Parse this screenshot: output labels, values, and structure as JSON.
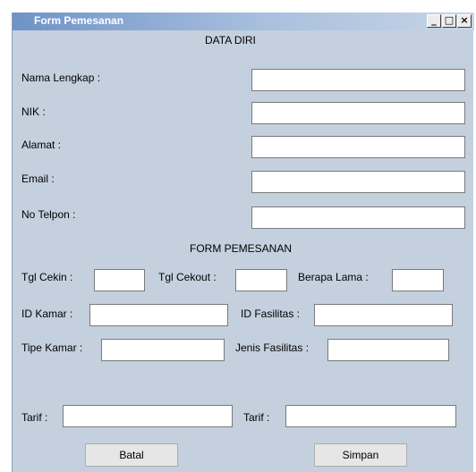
{
  "window": {
    "title": "Form Pemesanan",
    "controls": {
      "minimize": "_",
      "maximize": "□",
      "close": "×"
    }
  },
  "data_diri": {
    "heading": "DATA DIRI",
    "nama_label": "Nama Lengkap :",
    "nama_value": "",
    "nik_label": "NIK :",
    "nik_value": "",
    "alamat_label": "Alamat :",
    "alamat_value": "",
    "email_label": "Email :",
    "email_value": "",
    "telpon_label": "No Telpon :",
    "telpon_value": ""
  },
  "pemesanan": {
    "heading": "FORM PEMESANAN",
    "cekin_label": "Tgl Cekin :",
    "cekin_value": "",
    "cekout_label": "Tgl Cekout :",
    "cekout_value": "",
    "lama_label": "Berapa Lama :",
    "lama_value": "",
    "id_kamar_label": "ID Kamar :",
    "id_kamar_value": "",
    "id_fasilitas_label": "ID Fasilitas :",
    "id_fasilitas_value": "",
    "tipe_kamar_label": "Tipe Kamar :",
    "tipe_kamar_value": "",
    "jenis_fasilitas_label": "Jenis Fasilitas :",
    "jenis_fasilitas_value": "",
    "tarif_kamar_label": "Tarif :",
    "tarif_kamar_value": "",
    "tarif_fasilitas_label": "Tarif :",
    "tarif_fasilitas_value": ""
  },
  "buttons": {
    "batal": "Batal",
    "simpan": "Simpan"
  }
}
